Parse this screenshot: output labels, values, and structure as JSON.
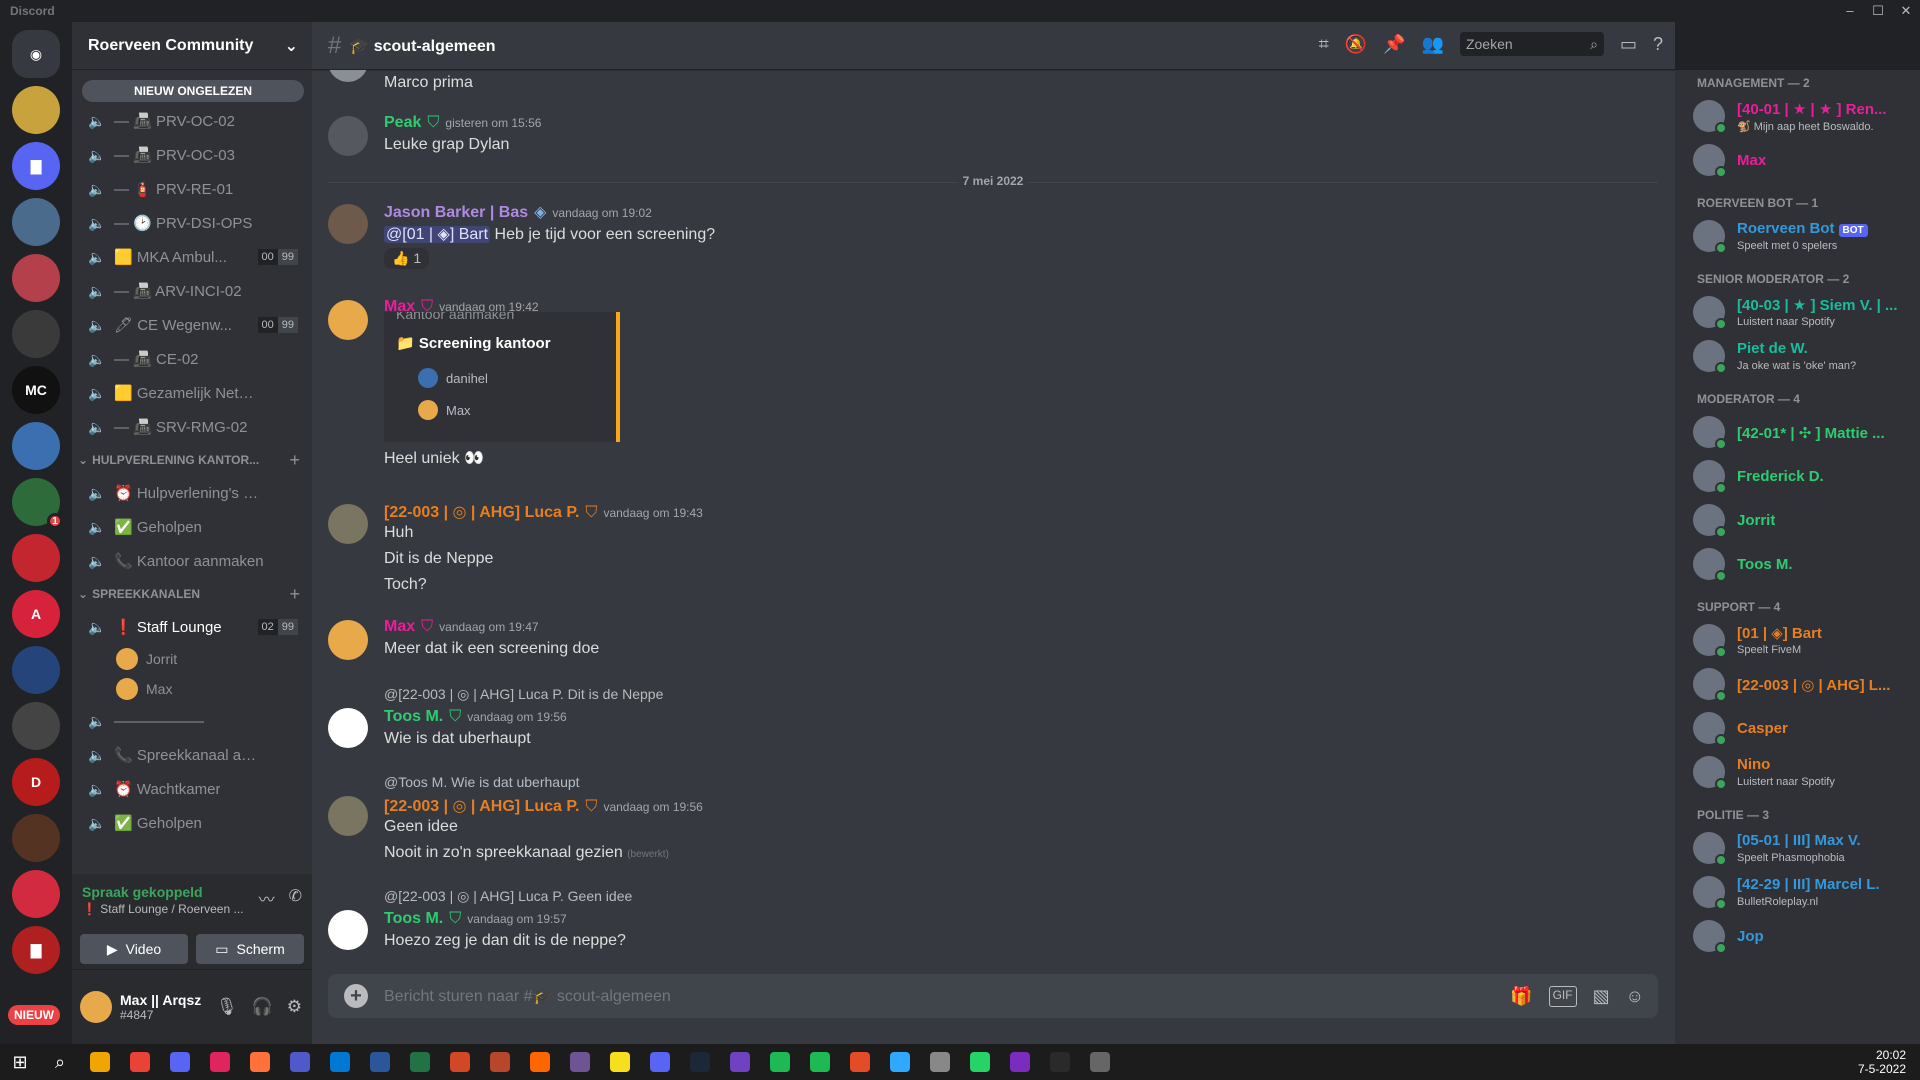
{
  "window": {
    "title": "Discord",
    "controls": [
      "–",
      "☐",
      "✕"
    ]
  },
  "servers": [
    {
      "color": "#36393f",
      "label": "◉"
    },
    {
      "color": "#c8a23c",
      "label": ""
    },
    {
      "color": "#5865f2",
      "label": "▇"
    },
    {
      "color": "#4a6b8c",
      "label": ""
    },
    {
      "color": "#b3404a",
      "label": ""
    },
    {
      "color": "#3a3a3a",
      "label": ""
    },
    {
      "color": "#111",
      "label": "MC"
    },
    {
      "color": "#3b6fb0",
      "label": ""
    },
    {
      "color": "#2d6b3a",
      "label": "",
      "ping": "1"
    },
    {
      "color": "#c3262f",
      "label": ""
    },
    {
      "color": "#d6223a",
      "label": "A"
    },
    {
      "color": "#25457a",
      "label": ""
    },
    {
      "color": "#444",
      "label": ""
    },
    {
      "color": "#b71c1c",
      "label": "D"
    },
    {
      "color": "#553322",
      "label": ""
    },
    {
      "color": "#d22b3f",
      "label": ""
    },
    {
      "color": "#b02020",
      "label": "▇"
    }
  ],
  "new_badge": "NIEUW",
  "guild": {
    "name": "Roerveen Community",
    "unread_pill": "NIEUW ONGELEZEN"
  },
  "channels_top": [
    {
      "label": "— 📠 PRV-OC-02"
    },
    {
      "label": "— 📠 PRV-OC-03"
    },
    {
      "label": "— 🧯 PRV-RE-01"
    },
    {
      "label": "— 🕑 PRV-DSI-OPS"
    },
    {
      "label": "🟨 MKA Ambul...",
      "cnt": [
        "00",
        "99"
      ]
    },
    {
      "label": "— 📠 ARV-INCI-02"
    },
    {
      "label": "🖊 CE Wegenw...",
      "cnt": [
        "00",
        "99"
      ]
    },
    {
      "label": "— 📠 CE-02"
    },
    {
      "label": "🟨 Gezamelijk Netwerk"
    },
    {
      "label": "— 📠 SRV-RMG-02"
    }
  ],
  "cat_hulp": "HULPVERLENING KANTOR...",
  "channels_hulp": [
    {
      "label": "⏰ Hulpverlening's Wa..."
    },
    {
      "label": "✅ Geholpen"
    },
    {
      "label": "📞 Kantoor aanmaken"
    }
  ],
  "cat_spreek": "SPREEKKANALEN",
  "staff_lounge": {
    "label": "❗ Staff Lounge",
    "cnt": [
      "02",
      "99"
    ],
    "users": [
      "Jorrit",
      "Max"
    ]
  },
  "channels_spreek": [
    {
      "label": "——————"
    },
    {
      "label": "📞 Spreekkanaal aanm..."
    },
    {
      "label": "⏰ Wachtkamer"
    },
    {
      "label": "✅ Geholpen"
    }
  ],
  "voice": {
    "status": "Spraak gekoppeld",
    "sub": "❗ Staff Lounge / Roerveen ...",
    "video": "Video",
    "screen": "Scherm"
  },
  "user": {
    "name": "Max || Arqsz",
    "tag": "#4847"
  },
  "channel": {
    "name": "🎓 scout-algemeen",
    "search": "Zoeken"
  },
  "messages": {
    "m0": {
      "text": "Marco prima"
    },
    "m1": {
      "author": "Peak",
      "time": "gisteren om 15:56",
      "text": "Leuke grap Dylan"
    },
    "divider": "7 mei 2022",
    "m2": {
      "author": "Jason Barker | Bas",
      "time": "vandaag om 19:02",
      "mention": "@[01 | ◈] Bart",
      "text": "Heb je tijd voor een screening?",
      "reaction": "👍 1"
    },
    "m3": {
      "author": "Max",
      "time": "vandaag om 19:42",
      "embed_cut": "Kantoor aanmaken",
      "embed_channel": "📁 Screening kantoor",
      "embed_u1": "danihel",
      "embed_u2": "Max",
      "text": "Heel uniek 👀"
    },
    "m4": {
      "author": "[22-003 | ◎ | AHG] Luca P.",
      "time": "vandaag om 19:43",
      "l1": "Huh",
      "l2": "Dit is de Neppe",
      "l3": "Toch?"
    },
    "m5": {
      "author": "Max",
      "time": "vandaag om 19:47",
      "text": "Meer dat ik een screening doe"
    },
    "m6": {
      "reply_name": "@[22-003 | ◎ | AHG] Luca P.",
      "reply_text": "Dit is de Neppe",
      "author": "Toos M.",
      "time": "vandaag om 19:56",
      "text": "Wie is dat uberhaupt"
    },
    "m7": {
      "reply_name": "@Toos M.",
      "reply_text": "Wie is dat uberhaupt",
      "author": "[22-003 | ◎ | AHG] Luca P.",
      "time": "vandaag om 19:56",
      "l1": "Geen idee",
      "l2": "Nooit in zo'n spreekkanaal gezien",
      "edited": "(bewerkt)"
    },
    "m8": {
      "reply_name": "@[22-003 | ◎ | AHG] Luca P.",
      "reply_text": "Geen idee",
      "author": "Toos M.",
      "time": "vandaag om 19:57",
      "text": "Hoezo zeg je dan dit is de neppe?"
    }
  },
  "composer": {
    "placeholder": "Bericht sturen naar #🎓 scout-algemeen"
  },
  "members": {
    "management": "MANAGEMENT — 2",
    "mgmt": [
      {
        "name": "[40-01 | ★ | ★ ] Ren...",
        "status": "🐒 Mijn aap heet Boswaldo.",
        "color": "#e91e9a"
      },
      {
        "name": "Max",
        "status": "",
        "color": "#e91e9a"
      }
    ],
    "bot_cat": "ROERVEEN BOT — 1",
    "bot": {
      "name": "Roerveen Bot",
      "badge": "BOT",
      "status": "Speelt met 0 spelers",
      "color": "#3498db"
    },
    "senior": "SENIOR MODERATOR — 2",
    "seniors": [
      {
        "name": "[40-03 | ★ ] Siem V. | ...",
        "status": "Luistert naar Spotify",
        "color": "#1abc9c"
      },
      {
        "name": "Piet de W.",
        "status": "Ja oke wat is 'oke' man?",
        "color": "#1abc9c"
      }
    ],
    "moderator": "MODERATOR — 4",
    "mods": [
      {
        "name": "[42-01* | ✣ ] Mattie ...",
        "status": "",
        "color": "#2ecc71"
      },
      {
        "name": "Frederick D.",
        "status": "",
        "color": "#2ecc71"
      },
      {
        "name": "Jorrit",
        "status": "",
        "color": "#2ecc71"
      },
      {
        "name": "Toos M.",
        "status": "",
        "color": "#2ecc71"
      }
    ],
    "support": "SUPPORT — 4",
    "supports": [
      {
        "name": "[01 | ◈] Bart",
        "status": "Speelt FiveM",
        "color": "#e67e22"
      },
      {
        "name": "[22-003 | ◎ | AHG] L...",
        "status": "",
        "color": "#e67e22"
      },
      {
        "name": "Casper",
        "status": "",
        "color": "#e67e22"
      },
      {
        "name": "Nino",
        "status": "Luistert naar Spotify",
        "color": "#e67e22"
      }
    ],
    "politie": "POLITIE — 3",
    "politie_members": [
      {
        "name": "[05-01 | III] Max V.",
        "status": "Speelt Phasmophobia",
        "color": "#3498db"
      },
      {
        "name": "[42-29 | III] Marcel L.",
        "status": "BulletRoleplay.nl",
        "color": "#3498db"
      },
      {
        "name": "Jop",
        "status": "",
        "color": "#3498db"
      }
    ]
  },
  "taskbar": {
    "time": "20:02",
    "date": "7-5-2022",
    "apps": [
      "#f0a500",
      "#ea4335",
      "#5865f2",
      "#e0245e",
      "#ff7139",
      "#5059c9",
      "#0078d4",
      "#2b579a",
      "#217346",
      "#d24726",
      "#b7472a",
      "#ff6600",
      "#6e5494",
      "#f7df1e",
      "#5865f2",
      "#1b2838",
      "#6f42c1",
      "#1db954",
      "#1db954",
      "#e34c26",
      "#31a8ff",
      "#888",
      "#25d366",
      "#7b2cbf",
      "#2a2a2a",
      "#666"
    ]
  }
}
